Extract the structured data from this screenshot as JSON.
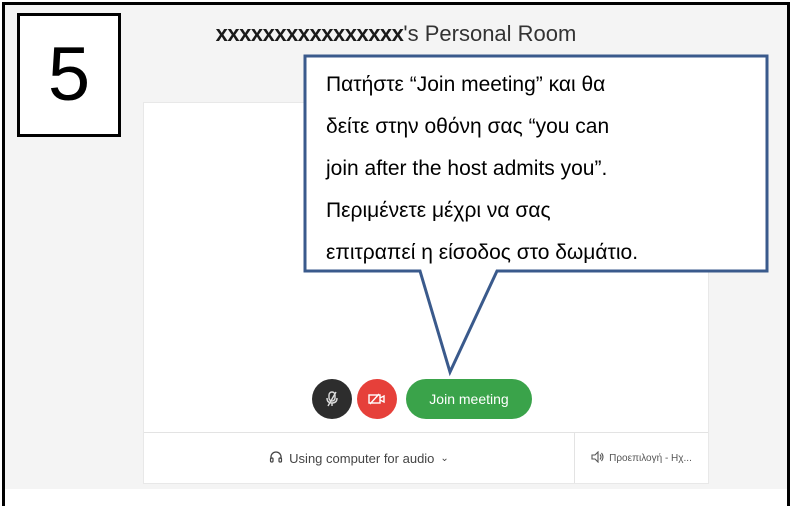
{
  "step": {
    "number": "5"
  },
  "room": {
    "name": "xxxxxxxxxxxxxxxx",
    "suffix": "'s Personal Room"
  },
  "callout": {
    "lines": [
      "Πατήστε “Join meeting” και θα",
      "δείτε στην οθόνη σας “you can",
      "join after the host admits you”.",
      "Περιμένετε μέχρι να σας",
      "επιτραπεί η είσοδος στο δωμάτιο."
    ],
    "border_color": "#3a5a8c"
  },
  "controls": {
    "join_label": "Join meeting",
    "join_color": "#3aa34a",
    "video_color": "#e6403a",
    "mute_color": "#2d2d2d"
  },
  "footer": {
    "audio_label": "Using computer for audio",
    "speaker_label": "Προεπιλογή - Ηχ..."
  },
  "icons": {
    "mute": "microphone-muted-icon",
    "video": "camera-off-icon",
    "audio": "headset-icon",
    "speaker": "speaker-icon",
    "chevron": "chevron-down-icon"
  }
}
